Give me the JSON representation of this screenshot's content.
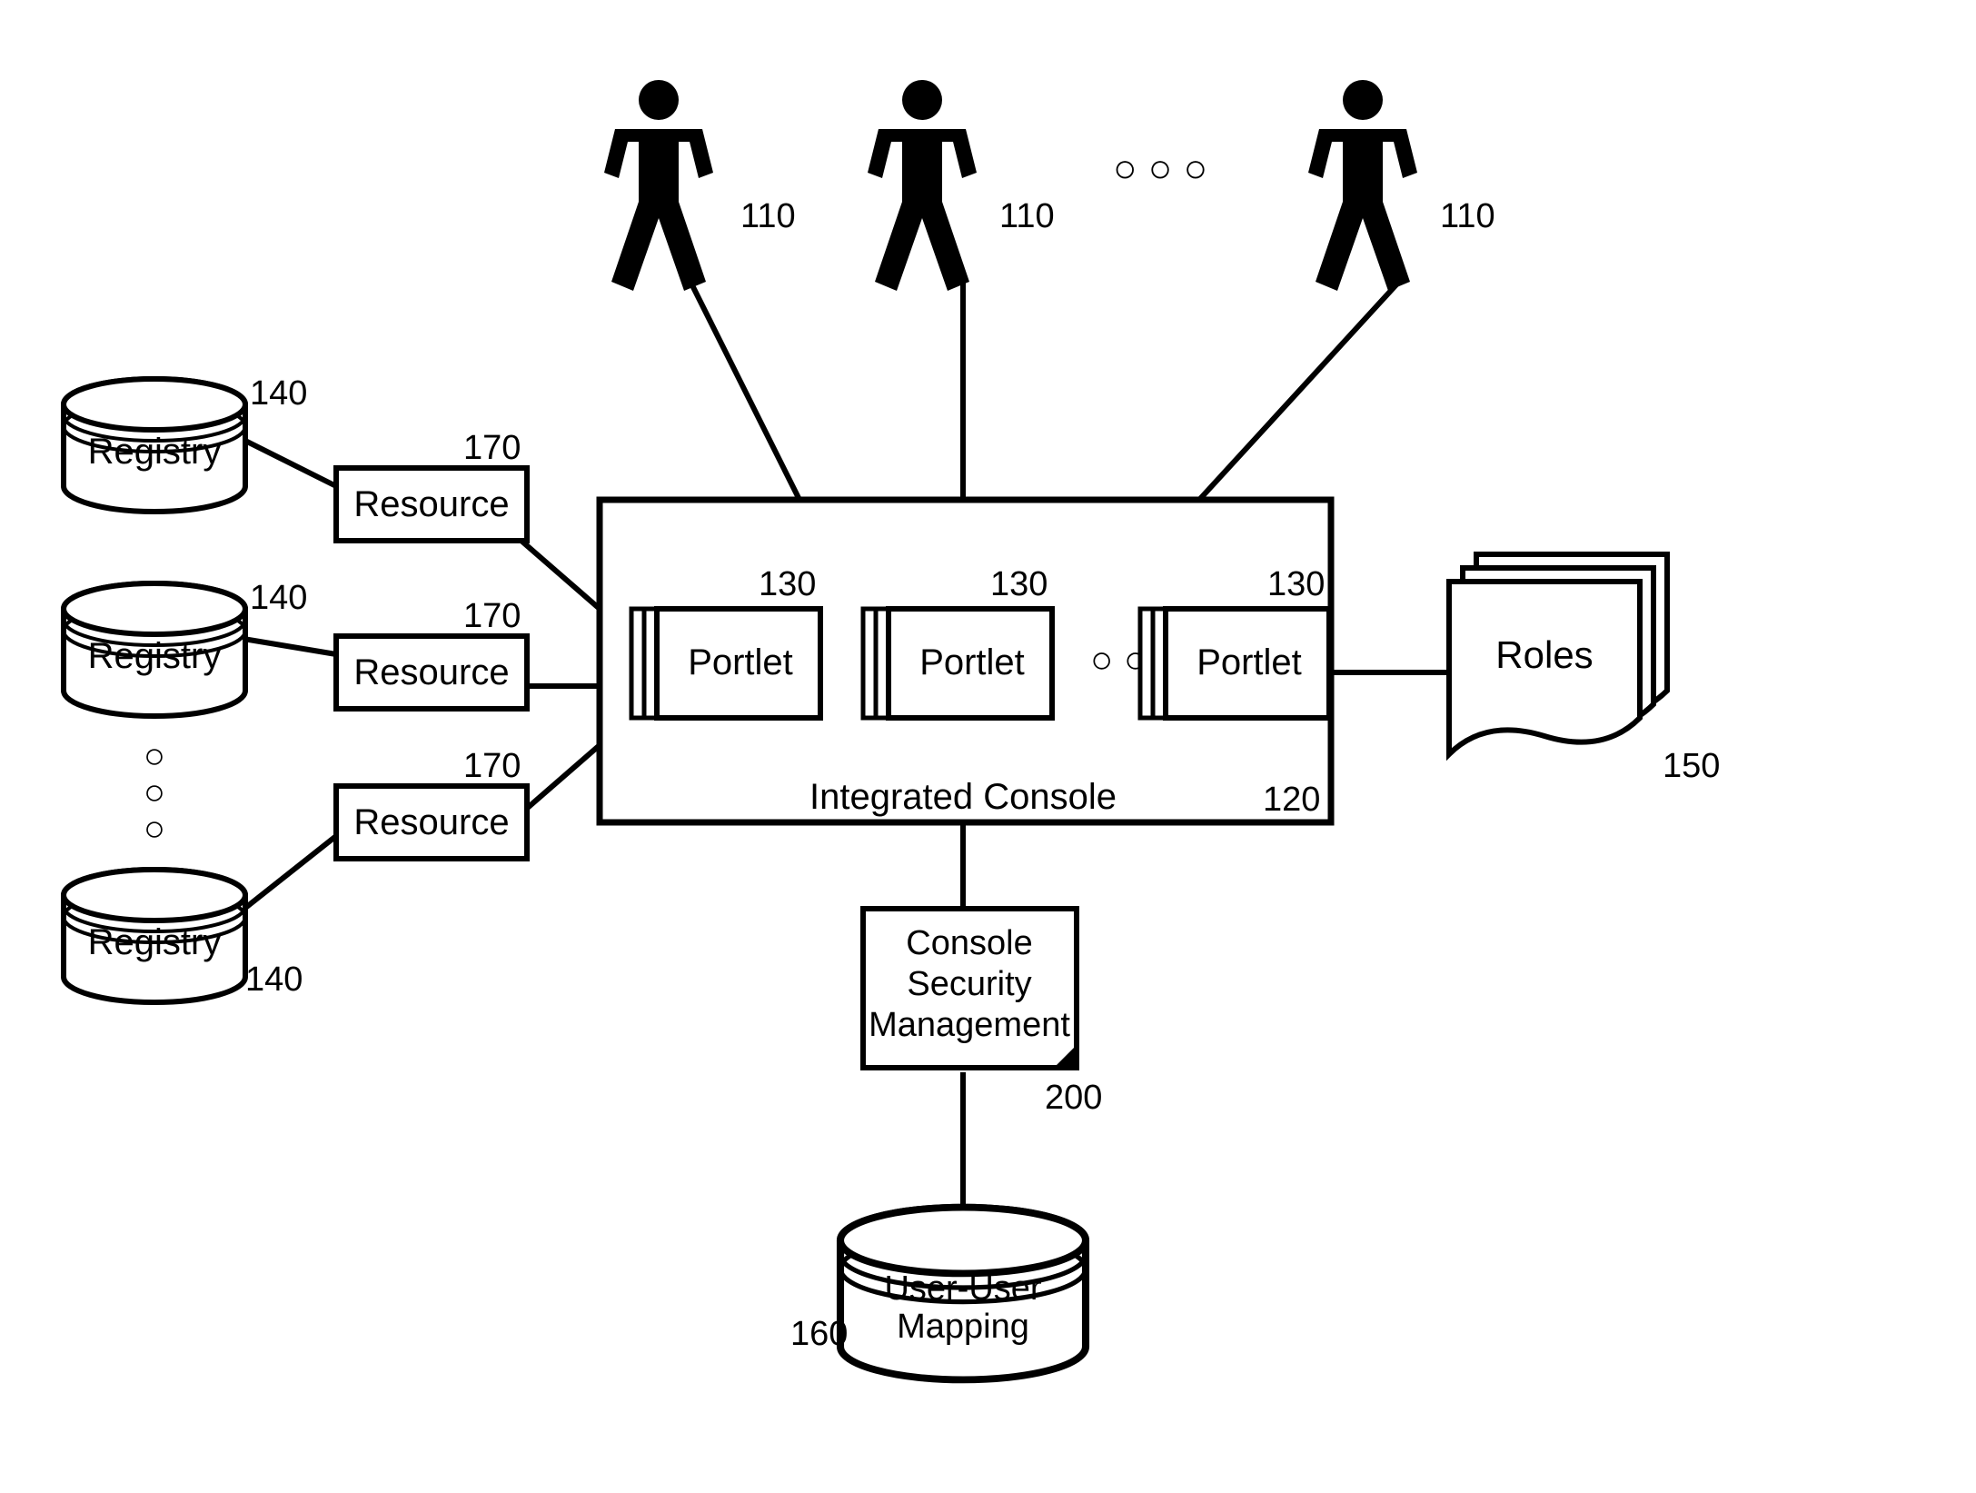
{
  "people": {
    "label": "110",
    "ellipsis": "○ ○ ○"
  },
  "registry": {
    "label": "Registry",
    "ref": "140",
    "ellipsis_glyphs": [
      "○",
      "○",
      "○"
    ]
  },
  "resource": {
    "label": "Resource",
    "ref": "170"
  },
  "console": {
    "label": "Integrated Console",
    "ref": "120"
  },
  "portlet": {
    "label": "Portlet",
    "ref": "130",
    "ellipsis": "○ ○ ○"
  },
  "roles": {
    "label": "Roles",
    "ref": "150"
  },
  "security": {
    "line1": "Console",
    "line2": "Security",
    "line3": "Management",
    "ref": "200"
  },
  "mapping": {
    "line1": "User-User",
    "line2": "Mapping",
    "ref": "160"
  }
}
